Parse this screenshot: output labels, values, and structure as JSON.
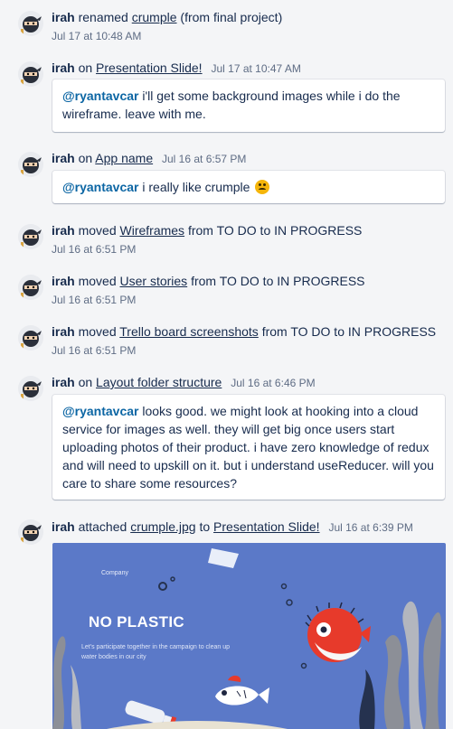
{
  "activity": [
    {
      "user": "irah",
      "action": "renamed",
      "link": "crumple",
      "suffix": "(from final project)",
      "time": "Jul 17 at 10:48 AM"
    },
    {
      "user": "irah",
      "action": "on",
      "link": "Presentation Slide!",
      "time": "Jul 17 at 10:47 AM",
      "comment": {
        "mention": "@ryantavcar",
        "text": "i'll get some background images while i do the wireframe. leave with me."
      }
    },
    {
      "user": "irah",
      "action": "on",
      "link": "App name",
      "time": "Jul 16 at 6:57 PM",
      "comment": {
        "mention": "@ryantavcar",
        "text": "i really like crumple"
      }
    },
    {
      "user": "irah",
      "action": "moved",
      "link": "Wireframes",
      "suffix": "from TO DO to IN PROGRESS",
      "time": "Jul 16 at 6:51 PM"
    },
    {
      "user": "irah",
      "action": "moved",
      "link": "User stories",
      "suffix": "from TO DO to IN PROGRESS",
      "time": "Jul 16 at 6:51 PM"
    },
    {
      "user": "irah",
      "action": "moved",
      "link": "Trello board screenshots",
      "suffix": "from TO DO to IN PROGRESS",
      "time": "Jul 16 at 6:51 PM"
    },
    {
      "user": "irah",
      "action": "on",
      "link": "Layout folder structure",
      "time": "Jul 16 at 6:46 PM",
      "comment": {
        "mention": "@ryantavcar",
        "text": "looks good. we might look at hooking into a cloud service for images as well. they will get big once users start uploading photos of their product. i have zero knowledge of redux and will need to upskill on it. but i understand useReducer. will you care to share some resources?"
      }
    },
    {
      "user": "irah",
      "action": "attached",
      "link": "crumple.jpg",
      "link_sep": "to",
      "link2": "Presentation Slide!",
      "time": "Jul 16 at 6:39 PM"
    }
  ],
  "attachment_preview": {
    "company": "Company",
    "title": "NO PLASTIC",
    "subtitle": "Let's participate together in the campaign to clean up water bodies in our city"
  },
  "colors": {
    "background": "#f4f5f7",
    "mention": "#0c66a4",
    "attachment_bg": "#5b79c8"
  }
}
